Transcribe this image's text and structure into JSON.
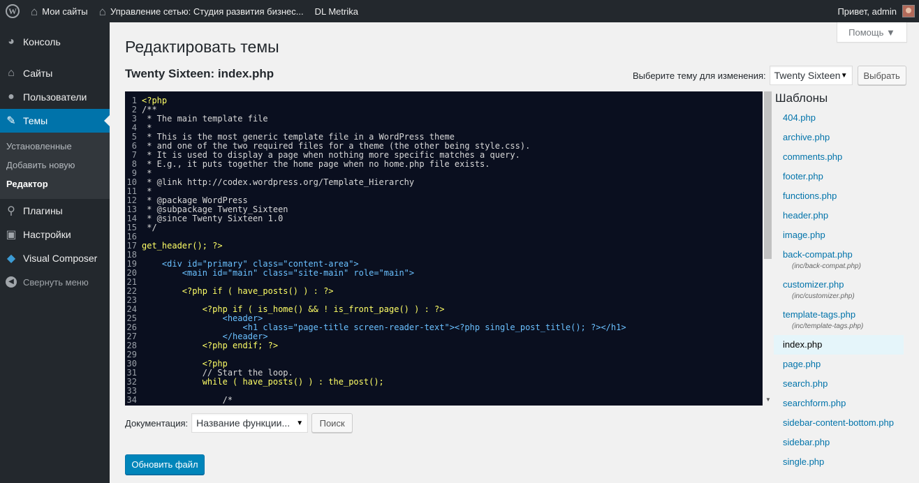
{
  "adminbar": {
    "my_sites": "Мои сайты",
    "network_admin": "Управление сетью: Студия развития бизнес...",
    "metrika": "DL Metrika",
    "greeting": "Привет, admin"
  },
  "sidebar": {
    "items": [
      {
        "label": "Консоль",
        "icon": "dashboard-icon"
      },
      {
        "label": "Сайты",
        "icon": "sites-icon"
      },
      {
        "label": "Пользователи",
        "icon": "users-icon"
      },
      {
        "label": "Темы",
        "icon": "themes-icon"
      },
      {
        "label": "Плагины",
        "icon": "plugins-icon"
      },
      {
        "label": "Настройки",
        "icon": "settings-icon"
      },
      {
        "label": "Visual Composer",
        "icon": "visual-composer-icon"
      }
    ],
    "submenu": [
      "Установленные",
      "Добавить новую",
      "Редактор"
    ],
    "collapse": "Свернуть меню"
  },
  "help_tab": "Помощь ▼",
  "page_title": "Редактировать темы",
  "file_title": "Twenty Sixteen: index.php",
  "theme_select": {
    "label": "Выберите тему для изменения:",
    "value": "Twenty Sixteen",
    "button": "Выбрать"
  },
  "code_lines": [
    "<?php",
    "/**",
    " * The main template file",
    " *",
    " * This is the most generic template file in a WordPress theme",
    " * and one of the two required files for a theme (the other being style.css).",
    " * It is used to display a page when nothing more specific matches a query.",
    " * E.g., it puts together the home page when no home.php file exists.",
    " *",
    " * @link http://codex.wordpress.org/Template_Hierarchy",
    " *",
    " * @package WordPress",
    " * @subpackage Twenty_Sixteen",
    " * @since Twenty Sixteen 1.0",
    " */",
    "",
    "get_header(); ?>",
    "",
    "    <div id=\"primary\" class=\"content-area\">",
    "        <main id=\"main\" class=\"site-main\" role=\"main\">",
    "",
    "        <?php if ( have_posts() ) : ?>",
    "",
    "            <?php if ( is_home() && ! is_front_page() ) : ?>",
    "                <header>",
    "                    <h1 class=\"page-title screen-reader-text\"><?php single_post_title(); ?></h1>",
    "                </header>",
    "            <?php endif; ?>",
    "",
    "            <?php",
    "            // Start the loop.",
    "            while ( have_posts() ) : the_post();",
    "",
    "                /*"
  ],
  "templates": {
    "heading": "Шаблоны",
    "items": [
      {
        "name": "404.php"
      },
      {
        "name": "archive.php"
      },
      {
        "name": "comments.php"
      },
      {
        "name": "footer.php"
      },
      {
        "name": "functions.php"
      },
      {
        "name": "header.php"
      },
      {
        "name": "image.php"
      },
      {
        "name": "back-compat.php",
        "sub": "(inc/back-compat.php)"
      },
      {
        "name": "customizer.php",
        "sub": "(inc/customizer.php)"
      },
      {
        "name": "template-tags.php",
        "sub": "(inc/template-tags.php)"
      },
      {
        "name": "index.php",
        "current": true
      },
      {
        "name": "page.php"
      },
      {
        "name": "search.php"
      },
      {
        "name": "searchform.php"
      },
      {
        "name": "sidebar-content-bottom.php"
      },
      {
        "name": "sidebar.php"
      },
      {
        "name": "single.php"
      }
    ]
  },
  "documentation": {
    "label": "Документация:",
    "select_value": "Название функции...",
    "button": "Поиск"
  },
  "update_button": "Обновить файл",
  "colors": {
    "accent": "#0073aa",
    "editor_bg": "#0a0f1f",
    "adminbar_bg": "#23282d"
  }
}
